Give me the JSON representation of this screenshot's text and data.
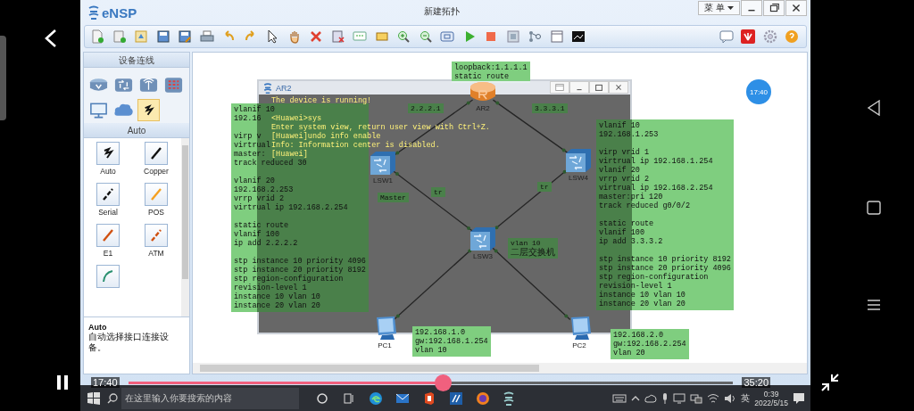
{
  "window": {
    "logo": "eNSP",
    "title": "新建拓扑",
    "menu_button": "菜 单"
  },
  "device_panel": {
    "title": "设备连线",
    "categories": [
      {
        "kind": "router",
        "selected": false
      },
      {
        "kind": "switch",
        "selected": false
      },
      {
        "kind": "wireless",
        "selected": false
      },
      {
        "kind": "firewall",
        "selected": false
      },
      {
        "kind": "pc",
        "selected": false
      },
      {
        "kind": "cloud",
        "selected": false
      },
      {
        "kind": "cable",
        "selected": true
      }
    ],
    "link_header": "Auto",
    "link_types": [
      {
        "kind": "auto",
        "label": "Auto"
      },
      {
        "kind": "copper",
        "label": "Copper"
      },
      {
        "kind": "serial",
        "label": "Serial"
      },
      {
        "kind": "pos",
        "label": "POS"
      },
      {
        "kind": "e1",
        "label": "E1"
      },
      {
        "kind": "atm",
        "label": "ATM"
      },
      {
        "kind": "ctl"
      }
    ],
    "description": {
      "title": "Auto",
      "text": "自动选择接口连接设备。"
    }
  },
  "topology": {
    "nodes": [
      {
        "kind": "router",
        "label": "AR2"
      },
      {
        "kind": "switch",
        "label": "LSW1"
      },
      {
        "kind": "switch",
        "label": "LSW3"
      },
      {
        "kind": "switch",
        "label": "LSW4"
      },
      {
        "kind": "pc",
        "label": "PC1"
      },
      {
        "kind": "pc",
        "label": "PC2"
      }
    ],
    "link_labels": [
      {
        "lines": [
          "2.2.2.1"
        ]
      },
      {
        "lines": [
          "3.3.3.1"
        ]
      },
      {
        "lines": [
          "Master"
        ]
      },
      {
        "lines": [
          "tr"
        ]
      },
      {
        "lines": [
          "tr"
        ]
      },
      {
        "lines": [
          "vlan 10",
          "二层交换机"
        ]
      }
    ],
    "notes": [
      {
        "blocks": [
          [
            "loopback:1.1.1.1",
            "static route"
          ]
        ]
      },
      {
        "blocks": [
          [
            "vlanif 10",
            "192.16"
          ],
          [
            "virp v",
            "virtrual",
            "master:",
            "track reduced 30"
          ],
          [
            "vlanif 20",
            "192.168.2.253",
            "vrrp vrid 2",
            "virtrual ip 192.168.2.254"
          ],
          [
            "static route",
            "vlanif 100",
            "ip add 2.2.2.2"
          ],
          [
            "stp instance 10 priority 4096",
            "stp instance 20 priority 8192",
            "stp region-configuration",
            "revision-level 1",
            "instance 10 vlan 10",
            "instance 20 vlan 20"
          ]
        ]
      },
      {
        "blocks": [
          [
            "vlanif 10",
            "192.168.1.253"
          ],
          [
            "virp vrid 1",
            "virtrual ip 192.168.1.254",
            "vlanif 20",
            "vrrp vrid 2",
            "virtrual ip 192.168.2.254",
            "master:pri 120",
            "track reduced g0/0/2"
          ],
          [
            "static route",
            "vlanif 100",
            "ip add 3.3.3.2"
          ],
          [
            "stp instance 10 priority 8192",
            "stp instance 20 priority 4096",
            "stp region-configuration",
            "revision-level 1",
            "instance 10 vlan 10",
            "instance 20 vlan 20"
          ]
        ]
      },
      {
        "blocks": [
          [
            "192.168.1.0",
            "gw:192.168.1.254",
            "vlan 10"
          ]
        ]
      },
      {
        "blocks": [
          [
            "192.168.2.0",
            "gw:192.168.2.254",
            "vlan 20"
          ]
        ]
      }
    ]
  },
  "console": {
    "title": "AR2",
    "lines": [
      "The device is running!",
      "<Huawei>sys",
      "Enter system view, return user view with Ctrl+Z.",
      "[Huawei]undo info enable",
      "Info: Information center is disabled.",
      "[Huawei]"
    ]
  },
  "clock_bubble": "17:40",
  "taskbar": {
    "search_placeholder": "在这里输入你要搜索的内容",
    "ime": "英",
    "time": "0:39",
    "date": "2022/5/15"
  },
  "player": {
    "playing": true,
    "elapsed": "17:40",
    "total": "35:20",
    "level": 0.52
  }
}
